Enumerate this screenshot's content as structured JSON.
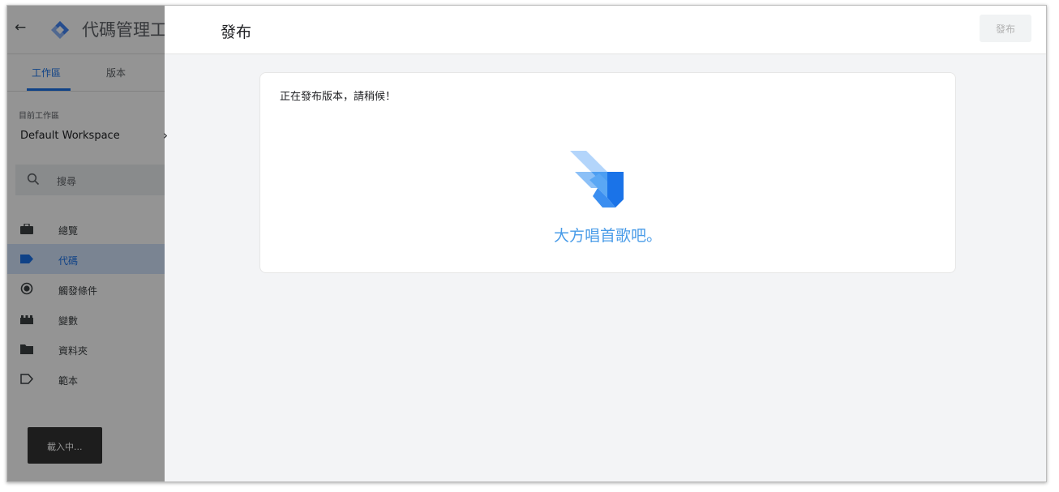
{
  "app": {
    "title": "代碼管理工具"
  },
  "header": {
    "page_title": "發布",
    "publish_button": "發布"
  },
  "sidebar": {
    "tabs": [
      {
        "label": "工作區",
        "active": true
      },
      {
        "label": "版本",
        "active": false
      }
    ],
    "workspace_label": "目前工作區",
    "workspace_name": "Default Workspace",
    "search_placeholder": "搜尋",
    "items": [
      {
        "label": "總覽",
        "icon": "briefcase-icon",
        "active": false
      },
      {
        "label": "代碼",
        "icon": "tag-icon",
        "active": true
      },
      {
        "label": "觸發條件",
        "icon": "trigger-icon",
        "active": false
      },
      {
        "label": "變數",
        "icon": "variables-icon",
        "active": false
      },
      {
        "label": "資料夾",
        "icon": "folder-icon",
        "active": false
      },
      {
        "label": "範本",
        "icon": "template-icon",
        "active": false
      }
    ]
  },
  "toast": {
    "text": "載入中..."
  },
  "card": {
    "status": "正在發布版本，請稍候！",
    "message": "大方唱首歌吧。"
  },
  "colors": {
    "accent": "#1a73e8",
    "message": "#4a9ce8",
    "toast_bg": "#323232",
    "overlay": "rgba(0,0,0,0.42)"
  }
}
